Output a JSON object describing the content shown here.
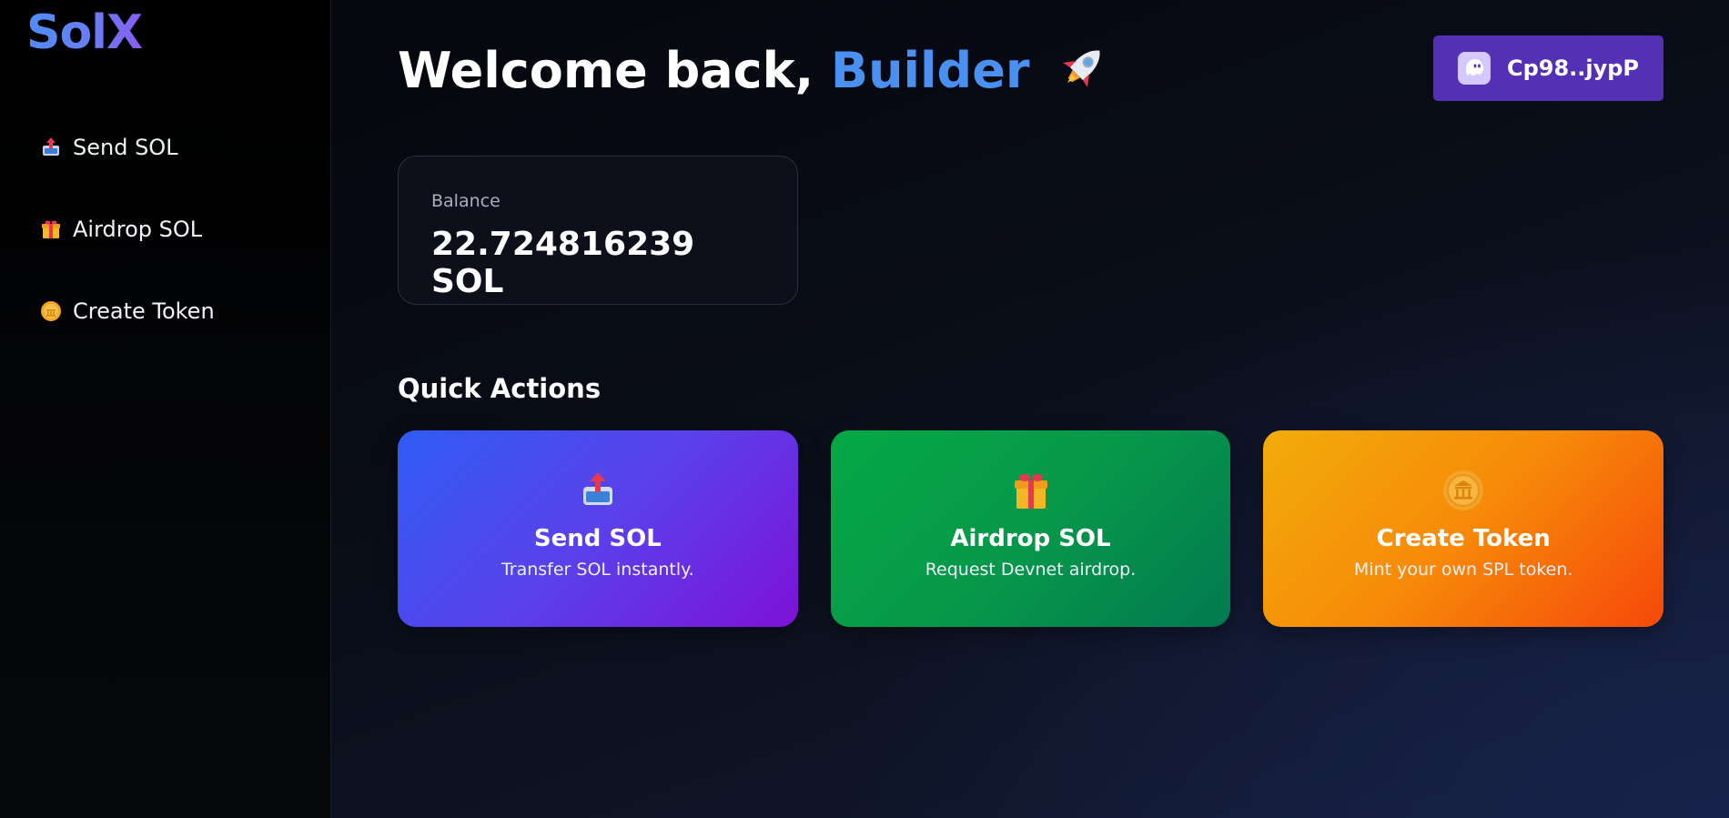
{
  "app": {
    "logo": "SolX"
  },
  "sidebar": {
    "items": [
      {
        "label": "Send SOL",
        "icon": "outbox-tray-icon"
      },
      {
        "label": "Airdrop SOL",
        "icon": "gift-icon"
      },
      {
        "label": "Create Token",
        "icon": "coin-icon"
      }
    ]
  },
  "header": {
    "greeting": "Welcome back,",
    "name": "Builder",
    "emoji": "rocket-icon"
  },
  "wallet": {
    "address": "Cp98..jypP",
    "icon": "phantom-ghost-icon",
    "color": "#5330b4"
  },
  "balance": {
    "label": "Balance",
    "value": "22.724816239 SOL"
  },
  "quick_actions": {
    "title": "Quick Actions",
    "cards": [
      {
        "title": "Send SOL",
        "desc": "Transfer SOL instantly.",
        "icon": "outbox-tray-icon"
      },
      {
        "title": "Airdrop SOL",
        "desc": "Request Devnet airdrop.",
        "icon": "gift-icon"
      },
      {
        "title": "Create Token",
        "desc": "Mint your own SPL token.",
        "icon": "coin-icon"
      }
    ]
  },
  "colors": {
    "accent_blue": "#4a90f0",
    "send_gradient": [
      "#2f5cf6",
      "#7d12d6"
    ],
    "airdrop_gradient": [
      "#05a844",
      "#017a4f"
    ],
    "token_gradient": [
      "#f1ac0a",
      "#f5480a"
    ]
  }
}
